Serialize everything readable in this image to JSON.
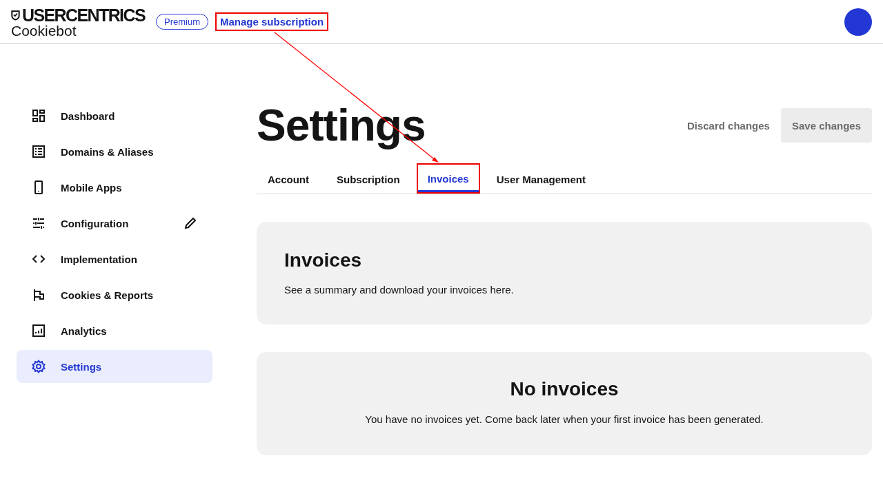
{
  "header": {
    "brand": "USERCENTRICS",
    "product": "Cookiebot",
    "plan_badge": "Premium",
    "manage_link": {
      "label": "Manage subscription",
      "highlighted": true
    }
  },
  "sidebar": {
    "items": [
      {
        "label": "Dashboard",
        "selected": false,
        "editable": false
      },
      {
        "label": "Domains & Aliases",
        "selected": false,
        "editable": false
      },
      {
        "label": "Mobile Apps",
        "selected": false,
        "editable": false
      },
      {
        "label": "Configuration",
        "selected": false,
        "editable": true
      },
      {
        "label": "Implementation",
        "selected": false,
        "editable": false
      },
      {
        "label": "Cookies & Reports",
        "selected": false,
        "editable": false
      },
      {
        "label": "Analytics",
        "selected": false,
        "editable": false
      },
      {
        "label": "Settings",
        "selected": true,
        "editable": false
      }
    ]
  },
  "page": {
    "title": "Settings",
    "discard_button": "Discard changes",
    "save_button": {
      "label": "Save changes",
      "disabled": true
    }
  },
  "tabs": [
    {
      "label": "Account",
      "selected": false,
      "highlighted": false
    },
    {
      "label": "Subscription",
      "selected": false,
      "highlighted": false
    },
    {
      "label": "Invoices",
      "selected": true,
      "highlighted": true
    },
    {
      "label": "User Management",
      "selected": false,
      "highlighted": false
    }
  ],
  "intro_card": {
    "title": "Invoices",
    "text": "See a summary and download your invoices here."
  },
  "empty_card": {
    "title": "No invoices",
    "text": "You have no invoices yet. Come back later when your first invoice has been generated."
  }
}
